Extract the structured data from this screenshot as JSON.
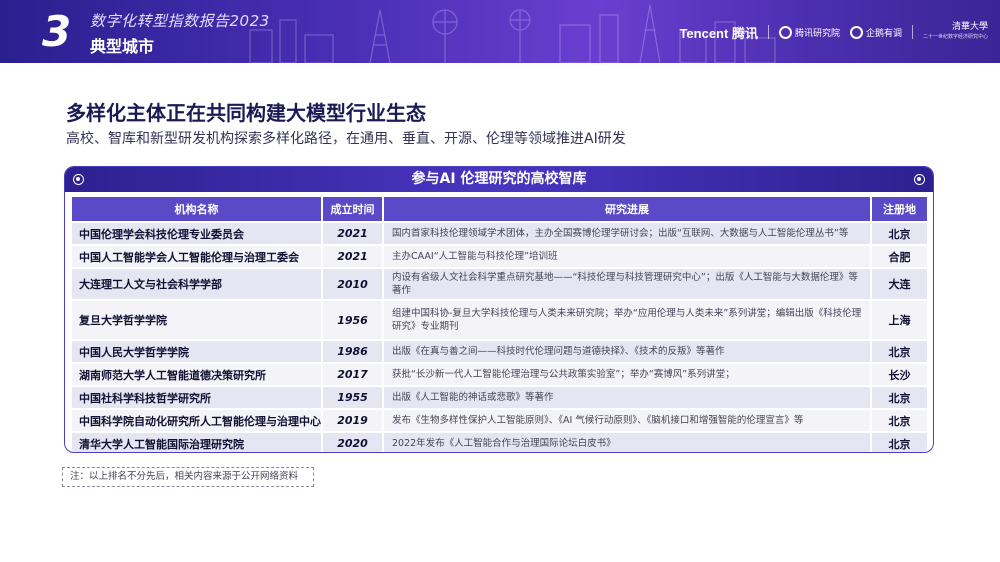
{
  "header": {
    "section_number": "3",
    "report_title": "数字化转型指数报告2023",
    "section_title": "典型城市",
    "logos": {
      "tencent": "Tencent 腾讯",
      "tencent_research": "腾讯研究院",
      "penguin_think": "企鹅有调",
      "tsinghua": "清華大學",
      "tsinghua_sub": "二十一世纪数字经济研究中心"
    }
  },
  "main_heading": "多样化主体正在共同构建大模型行业生态",
  "sub_heading": "高校、智库和新型研发机构探索多样化路径，在通用、垂直、开源、伦理等领域推进AI研发",
  "card": {
    "title": "参与AI 伦理研究的高校智库",
    "columns": [
      "机构名称",
      "成立时间",
      "研究进展",
      "注册地"
    ],
    "rows": [
      {
        "name": "中国伦理学会科技伦理专业委员会",
        "year": "2021",
        "progress": "国内首家科技伦理领域学术团体，主办全国赛博伦理学研讨会；出版“互联网、大数据与人工智能伦理丛书”等",
        "place": "北京"
      },
      {
        "name": "中国人工智能学会人工智能伦理与治理工委会",
        "year": "2021",
        "progress": "主办CAAI“人工智能与科技伦理”培训班",
        "place": "合肥"
      },
      {
        "name": "大连理工人文与社会科学学部",
        "year": "2010",
        "progress": "内设有省级人文社会科学重点研究基地——“科技伦理与科技管理研究中心”；出版《人工智能与大数据伦理》等著作",
        "place": "大连"
      },
      {
        "name": "复旦大学哲学学院",
        "year": "1956",
        "progress": "组建中国科协-复旦大学科技伦理与人类未来研究院；举办“应用伦理与人类未来”系列讲堂；编辑出版《科技伦理研究》专业期刊",
        "place": "上海"
      },
      {
        "name": "中国人民大学哲学学院",
        "year": "1986",
        "progress": "出版《在真与善之间——科技时代伦理问题与道德抉择》、《技术的反叛》等著作",
        "place": "北京"
      },
      {
        "name": "湖南师范大学人工智能道德决策研究所",
        "year": "2017",
        "progress": "获批“长沙新一代人工智能伦理治理与公共政策实验室”；举办“赛博风”系列讲堂；",
        "place": "长沙"
      },
      {
        "name": "中国社科学科技哲学研究所",
        "year": "1955",
        "progress": "出版《人工智能的神话或悲歌》等著作",
        "place": "北京"
      },
      {
        "name": "中国科学院自动化研究所人工智能伦理与治理中心",
        "year": "2019",
        "progress": "发布《生物多样性保护人工智能原则》、《AI 气候行动原则》、《脑机接口和增强智能的伦理宣言》等",
        "place": "北京"
      },
      {
        "name": "清华大学人工智能国际治理研究院",
        "year": "2020",
        "progress": "2022年发布《人工智能合作与治理国际论坛白皮书》",
        "place": "北京"
      }
    ]
  },
  "note": "注：以上排名不分先后，相关内容来源于公开网络资料",
  "colors": {
    "banner_start": "#2a1f8f",
    "banner_end": "#6a3fd0",
    "table_header": "#5a4ac8",
    "heading": "#1a1a55"
  }
}
